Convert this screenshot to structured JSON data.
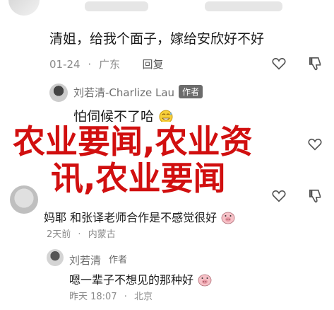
{
  "comment1": {
    "text": "清姐，给我个面子，嫁给安欣好不好",
    "date": "01-24",
    "location": "广东",
    "reply_label": "回复"
  },
  "reply1": {
    "name": "刘若清-Charlize Lau",
    "author_tag": "作者",
    "text": "怕伺候不了哈"
  },
  "overlay": {
    "line1": "农业要闻,农业资",
    "line2": "讯,农业要闻"
  },
  "comment2": {
    "text": "妈耶 和张译老师合作是不感觉很好",
    "time": "2天前",
    "location": "内蒙古"
  },
  "reply2": {
    "name": "刘若清",
    "author_tag": "作者",
    "text": "嗯一辈子不想见的那种好",
    "time": "昨天 18:07",
    "location": "北京"
  },
  "icons": [
    "heart-icon",
    "thumbs-down-icon",
    "avatar",
    "emoji-icon"
  ]
}
